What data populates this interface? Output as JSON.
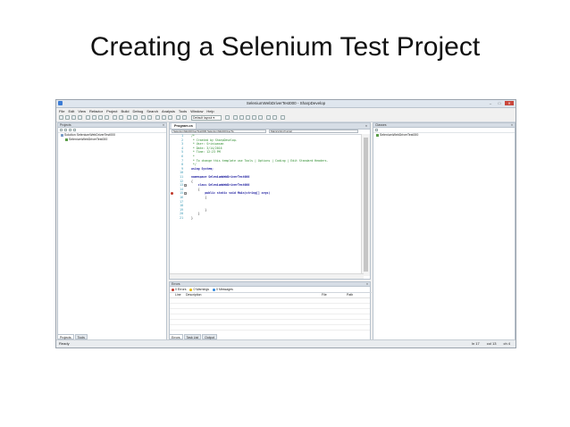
{
  "slide": {
    "title": "Creating a Selenium Test Project"
  },
  "window": {
    "title": "SeleniumWebDriverTest000 - SharpDevelop",
    "minimize": "–",
    "maximize": "□",
    "close": "✕"
  },
  "menu": [
    "File",
    "Edit",
    "View",
    "Refactor",
    "Project",
    "Build",
    "Debug",
    "Search",
    "Analysis",
    "Tools",
    "Window",
    "Help"
  ],
  "toolbar": {
    "layout_value": "Default layout ▾"
  },
  "projects_pane": {
    "header": "Projects",
    "close": "×",
    "tree": [
      "Solution SeleniumWebDriverTest000",
      "SeleniumWebDriverTest000"
    ],
    "tabs": [
      "Projects",
      "Tools"
    ]
  },
  "editor": {
    "tab": "Program.cs",
    "tab_close": "×",
    "nav_class": "SeleniumWebDriverTest000.SeleniumWebDriverTe",
    "nav_member": "Main(string[] args)",
    "lines": [
      {
        "n": "1",
        "t": "/*",
        "c": "cm"
      },
      {
        "n": "2",
        "t": " * Created by SharpDevelop.",
        "c": "cm"
      },
      {
        "n": "3",
        "t": " * User: Sriniwasan",
        "c": "cm"
      },
      {
        "n": "4",
        "t": " * Date: 3/14/2016",
        "c": "cm"
      },
      {
        "n": "5",
        "t": " * Time: 12:23 PM",
        "c": "cm"
      },
      {
        "n": "6",
        "t": " *",
        "c": "cm"
      },
      {
        "n": "7",
        "t": " * To change this template use Tools | Options | Coding | Edit Standard Headers.",
        "c": "cm"
      },
      {
        "n": "8",
        "t": " */",
        "c": "cm"
      },
      {
        "n": "9",
        "t": "using System;",
        "c": "kw"
      },
      {
        "n": "10",
        "t": "",
        "c": ""
      },
      {
        "n": "11",
        "t": "namespace SeleniumWebDriverTest000",
        "c": "kw"
      },
      {
        "n": "12",
        "t": "{",
        "c": ""
      },
      {
        "n": "13",
        "t": "    class SeleniumWebDriverTest000",
        "c": "kw"
      },
      {
        "n": "14",
        "t": "    {",
        "c": ""
      },
      {
        "n": "15",
        "t": "        public static void Main(string[] args)",
        "c": "kw"
      },
      {
        "n": "16",
        "t": "        {",
        "c": ""
      },
      {
        "n": "17",
        "t": "",
        "c": ""
      },
      {
        "n": "18",
        "t": "",
        "c": ""
      },
      {
        "n": "19",
        "t": "        }",
        "c": ""
      },
      {
        "n": "20",
        "t": "    }",
        "c": ""
      },
      {
        "n": "21",
        "t": "}",
        "c": ""
      }
    ]
  },
  "errors_pane": {
    "header": "Errors",
    "close": "×",
    "errors": "0 Errors",
    "warnings": "0 Warnings",
    "messages": "0 Messages",
    "col_line": "Line",
    "col_desc": "Description",
    "col_file": "File",
    "col_path": "Path",
    "tabs": [
      "Errors",
      "Task List",
      "Output"
    ]
  },
  "classes_pane": {
    "header": "Classes",
    "close": "×",
    "tree": [
      "SeleniumWebDriverTest000"
    ]
  },
  "status": {
    "ready": "Ready",
    "ln": "ln 17",
    "col": "col 13",
    "ch": "ch 4"
  },
  "colors": {
    "accent": "#3a7bd5",
    "error": "#c0392b",
    "warning": "#e6b800",
    "message": "#2e86de"
  }
}
